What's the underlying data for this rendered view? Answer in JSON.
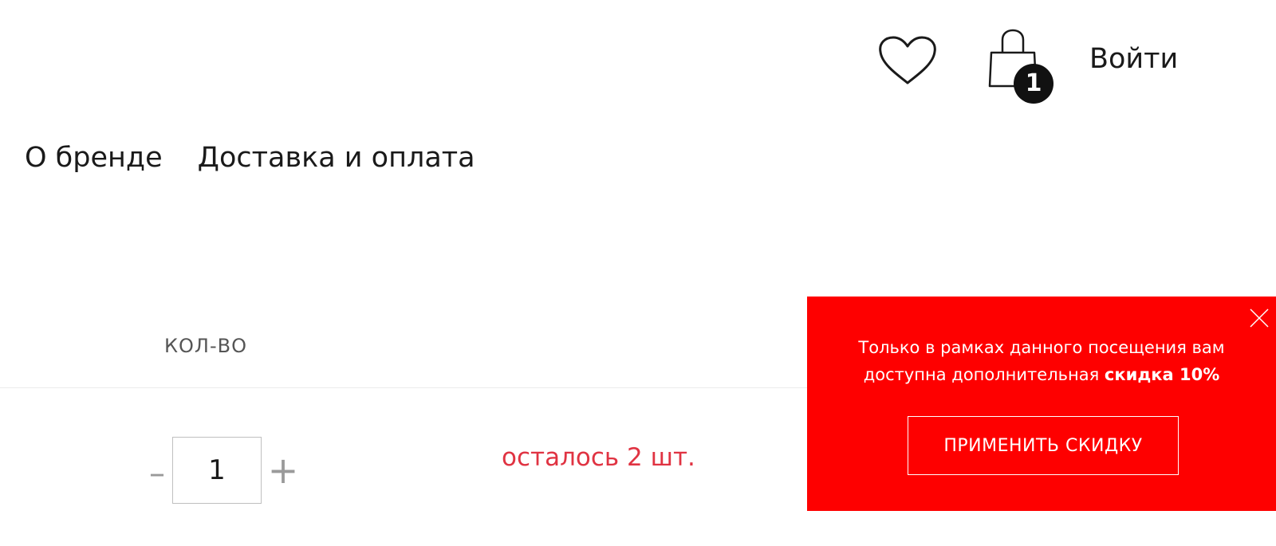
{
  "header": {
    "wishlist_icon": "heart-icon",
    "cart_icon": "shopping-bag-icon",
    "cart_count": "1",
    "login_label": "Войти"
  },
  "nav": {
    "items": [
      {
        "label": "О бренде"
      },
      {
        "label": "Доставка и оплата"
      }
    ]
  },
  "cart": {
    "qty_header": "КОЛ-ВО",
    "minus_symbol": "–",
    "plus_symbol": "+",
    "quantity": "1",
    "stock_note": "осталось 2 шт."
  },
  "promo": {
    "text_line1": "Только в рамках данного посещения вам",
    "text_line2_prefix": "доступна дополнительная ",
    "text_line2_bold": "скидка 10%",
    "button_label": "ПРИМЕНИТЬ СКИДКУ",
    "close_icon": "close-icon"
  },
  "colors": {
    "promo_background": "#fe0000",
    "stock_note": "#e03342",
    "badge": "#111111"
  }
}
